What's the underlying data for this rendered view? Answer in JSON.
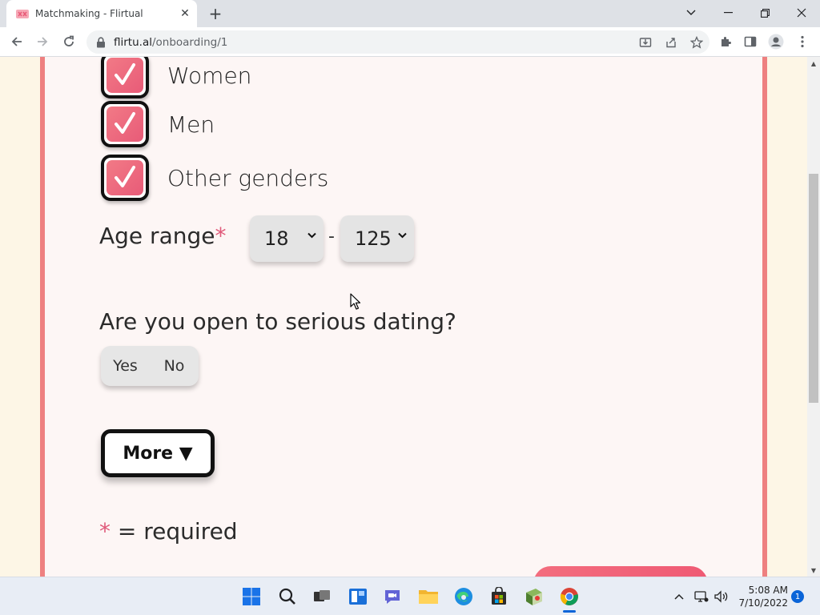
{
  "browser": {
    "tab_title": "Matchmaking - Flirtual",
    "tab_close_glyph": "✕",
    "new_tab_glyph": "+",
    "url_domain": "flirtu.al",
    "url_path": "/onboarding/1"
  },
  "form": {
    "genders": [
      {
        "label": "Women",
        "checked": true
      },
      {
        "label": "Men",
        "checked": true
      },
      {
        "label": "Other genders",
        "checked": true
      }
    ],
    "age_range": {
      "label": "Age range",
      "required_marker": "*",
      "min": "18",
      "max": "125",
      "separator": "-"
    },
    "serious_dating": {
      "question": "Are you open to serious dating?",
      "options": [
        "Yes",
        "No"
      ]
    },
    "more_button": "More ▼",
    "required_note": {
      "marker": "*",
      "text": " = required"
    }
  },
  "taskbar": {
    "time": "5:08 AM",
    "date": "7/10/2022",
    "notification_count": "1"
  },
  "colors": {
    "accent": "#ee8080",
    "checkbox_fill": "#e85b78",
    "required": "#e05a7a",
    "taskbar_active": "#0a64d8"
  }
}
